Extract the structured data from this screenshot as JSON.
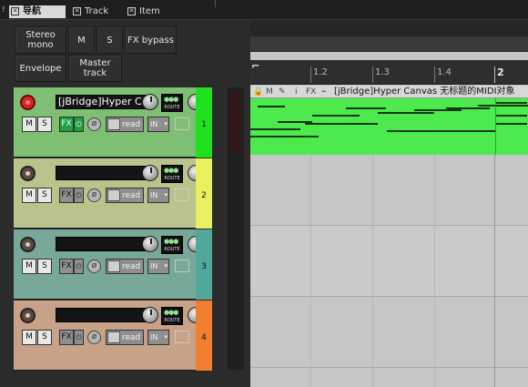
{
  "tabs": [
    {
      "label": "导航",
      "active": true
    },
    {
      "label": "Track",
      "active": false
    },
    {
      "label": "Item",
      "active": false
    }
  ],
  "toolbar": {
    "stereo_mono": "Stereo mono",
    "m": "M",
    "s": "S",
    "fx_bypass": "FX bypass",
    "envelope": "Envelope",
    "master_track": "Master track"
  },
  "tracks": [
    {
      "name": "[jBridge]Hyper Canv",
      "number": "1",
      "color": "#7fbf74",
      "meter": "#1ee01e",
      "armed": true,
      "fx_on": true,
      "m": "M",
      "s": "S",
      "fx": "FX",
      "read": "read",
      "in": "IN",
      "route": "ROUTE"
    },
    {
      "name": "",
      "number": "2",
      "color": "#b9c48c",
      "meter": "#e8f060",
      "armed": false,
      "fx_on": false,
      "m": "M",
      "s": "S",
      "fx": "FX",
      "read": "read",
      "in": "IN",
      "route": "ROUTE"
    },
    {
      "name": "",
      "number": "3",
      "color": "#78a89a",
      "meter": "#52a898",
      "armed": false,
      "fx_on": false,
      "m": "M",
      "s": "S",
      "fx": "FX",
      "read": "read",
      "in": "IN",
      "route": "ROUTE"
    },
    {
      "name": "",
      "number": "4",
      "color": "#c8a288",
      "meter": "#f08030",
      "armed": false,
      "fx_on": false,
      "m": "M",
      "s": "S",
      "fx": "FX",
      "read": "read",
      "in": "IN",
      "route": "ROUTE"
    }
  ],
  "ruler": {
    "labels": [
      "1.2",
      "1.3",
      "1.4",
      "2"
    ]
  },
  "media_item": {
    "title": "[jBridge]Hyper Canvas 无标题的MIDI对象",
    "buttons": [
      "M",
      "i",
      "FX"
    ]
  }
}
